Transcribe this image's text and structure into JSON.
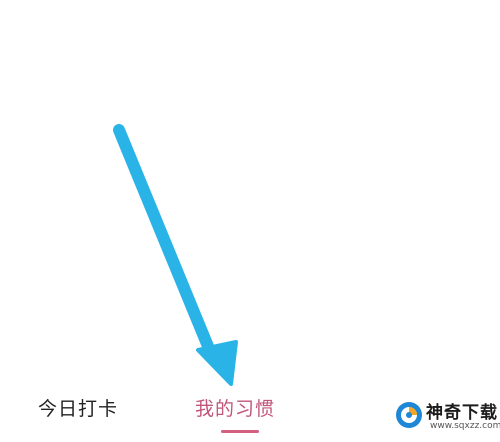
{
  "tabs": [
    {
      "label": "今日打卡",
      "active": false
    },
    {
      "label": "我的习惯",
      "active": true
    }
  ],
  "colors": {
    "active_tab": "#c0567a",
    "inactive_tab": "#222222",
    "indicator": "#d4607f",
    "arrow": "#29b3e6"
  },
  "annotation": {
    "icon": "arrow-pointer-icon",
    "points_to": "tab-my-habits"
  },
  "watermark": {
    "title": "神奇下载",
    "url": "www.sqxzz.com"
  }
}
